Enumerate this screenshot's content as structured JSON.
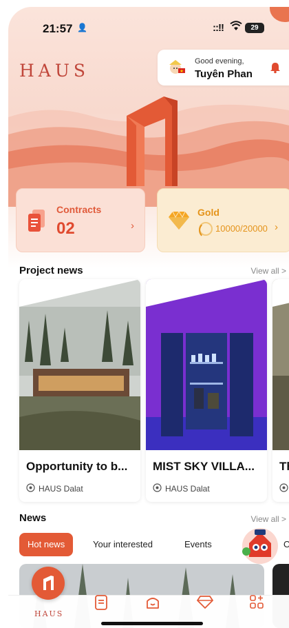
{
  "status_bar": {
    "time": "21:57",
    "person_glyph": "👤",
    "signal": "::!!",
    "wifi_glyph": "◉",
    "battery": "29"
  },
  "header": {
    "logo": "HAUS",
    "greeting": "Good evening,",
    "user_name": "Tuyên Phan",
    "avatar_icon": "avatar-icon",
    "bell_icon": "bell-icon"
  },
  "stats": {
    "contracts": {
      "label": "Contracts",
      "value": "02",
      "chevron": "›"
    },
    "gold": {
      "label": "Gold",
      "value": "10000/20000",
      "chevron": "›",
      "progress": 0.5
    }
  },
  "project_news": {
    "title": "Project news",
    "view_all": "View all >",
    "items": [
      {
        "name": "Opportunity to b...",
        "location": "HAUS Dalat"
      },
      {
        "name": "MIST SKY VILLA...",
        "location": "HAUS Dalat"
      },
      {
        "name": "Th",
        "location": ""
      }
    ]
  },
  "news": {
    "title": "News",
    "view_all": "View all >",
    "tabs": [
      {
        "label": "Hot news",
        "active": true
      },
      {
        "label": "Your interested",
        "active": false
      },
      {
        "label": "Events",
        "active": false
      },
      {
        "label": "O",
        "active": false
      }
    ]
  },
  "bottom_nav": {
    "home_label": "HAUS",
    "items": [
      "document-icon",
      "home-icon",
      "gem-icon",
      "apps-icon"
    ]
  },
  "colors": {
    "brand": "#e35a36",
    "gold": "#e4931a",
    "logo": "#c0463a"
  }
}
